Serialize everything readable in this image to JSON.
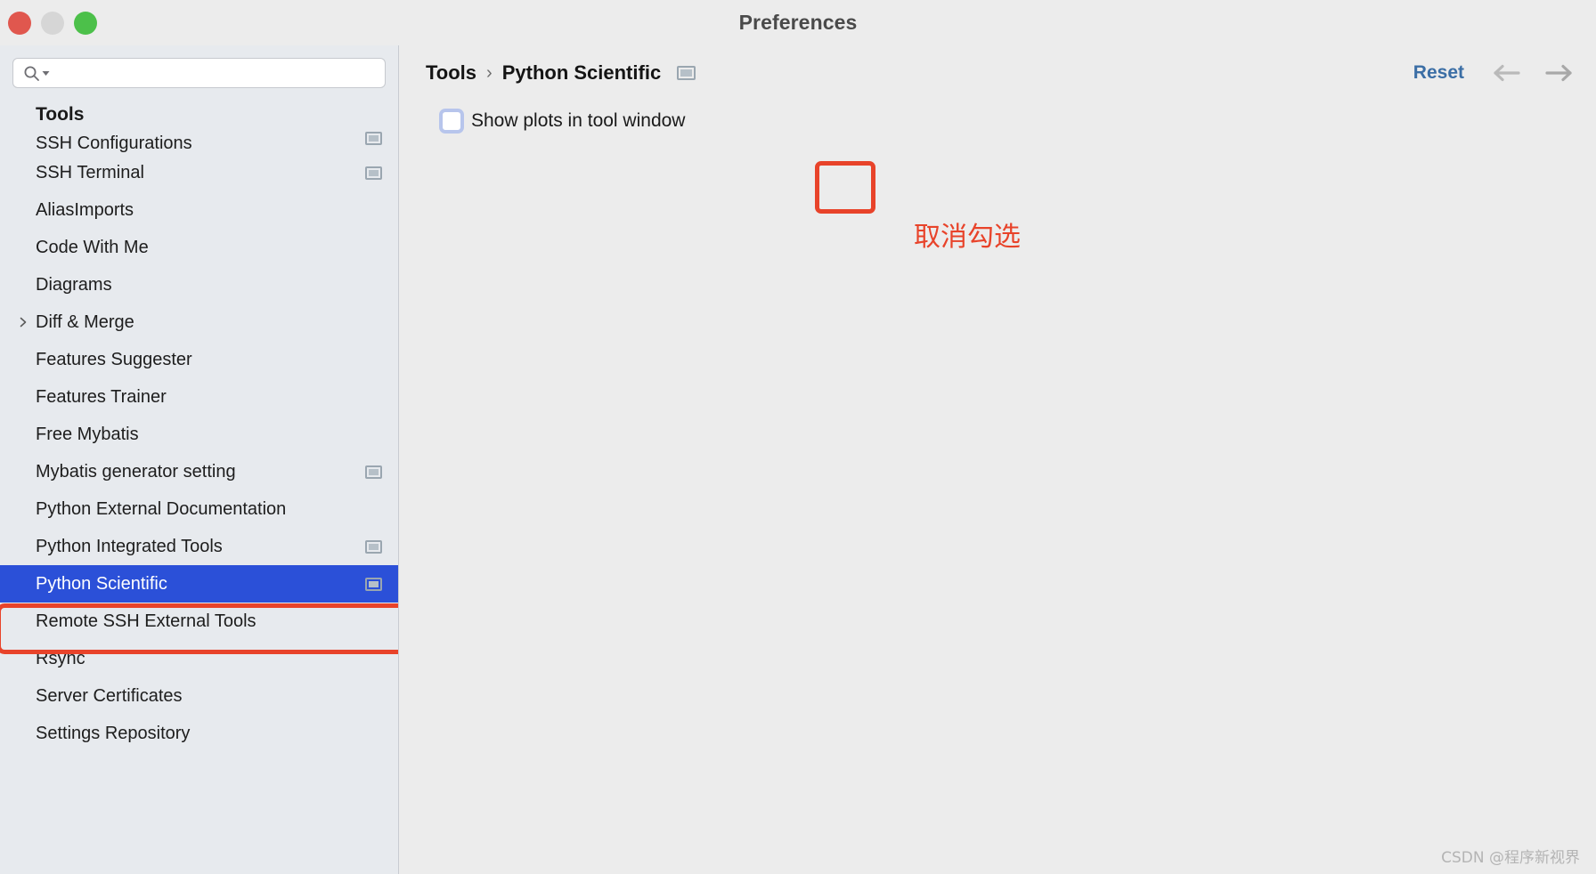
{
  "window": {
    "title": "Preferences",
    "traffic_lights": [
      "close-button",
      "minimize-button",
      "maximize-button"
    ]
  },
  "sidebar": {
    "search": {
      "value": "",
      "placeholder": "",
      "icon": "search-icon",
      "dropdown_icon": "chevron-down-icon"
    },
    "group_header": "Tools",
    "items": [
      {
        "label": "SSH Configurations",
        "panel_icon": true,
        "expandable": false,
        "selected": false,
        "clipped": true
      },
      {
        "label": "SSH Terminal",
        "panel_icon": true,
        "expandable": false,
        "selected": false
      },
      {
        "label": "AliasImports",
        "panel_icon": false,
        "expandable": false,
        "selected": false
      },
      {
        "label": "Code With Me",
        "panel_icon": false,
        "expandable": false,
        "selected": false
      },
      {
        "label": "Diagrams",
        "panel_icon": false,
        "expandable": false,
        "selected": false
      },
      {
        "label": "Diff & Merge",
        "panel_icon": false,
        "expandable": true,
        "selected": false
      },
      {
        "label": "Features Suggester",
        "panel_icon": false,
        "expandable": false,
        "selected": false
      },
      {
        "label": "Features Trainer",
        "panel_icon": false,
        "expandable": false,
        "selected": false
      },
      {
        "label": "Free Mybatis",
        "panel_icon": false,
        "expandable": false,
        "selected": false
      },
      {
        "label": "Mybatis generator setting",
        "panel_icon": true,
        "expandable": false,
        "selected": false
      },
      {
        "label": "Python External Documentation",
        "panel_icon": false,
        "expandable": false,
        "selected": false
      },
      {
        "label": "Python Integrated Tools",
        "panel_icon": true,
        "expandable": false,
        "selected": false
      },
      {
        "label": "Python Scientific",
        "panel_icon": true,
        "expandable": false,
        "selected": true
      },
      {
        "label": "Remote SSH External Tools",
        "panel_icon": false,
        "expandable": false,
        "selected": false
      },
      {
        "label": "Rsync",
        "panel_icon": false,
        "expandable": false,
        "selected": false
      },
      {
        "label": "Server Certificates",
        "panel_icon": false,
        "expandable": false,
        "selected": false
      },
      {
        "label": "Settings Repository",
        "panel_icon": false,
        "expandable": false,
        "selected": false
      }
    ]
  },
  "main": {
    "breadcrumb": {
      "root": "Tools",
      "separator": "›",
      "current": "Python Scientific",
      "panel_icon": "panel-window-icon"
    },
    "reset_label": "Reset",
    "back_icon": "arrow-left-icon",
    "forward_icon": "arrow-right-icon",
    "settings": {
      "show_plots": {
        "label": "Show plots in tool window",
        "checked": false
      }
    }
  },
  "annotations": {
    "checkbox_box": "red-highlight-rectangle",
    "sidebar_box": "red-highlight-rectangle",
    "note_text": "取消勾选",
    "note_color": "#e8432a"
  },
  "watermark": {
    "text": "CSDN @程序新视界"
  },
  "colors": {
    "selection_blue": "#2b50d8",
    "reset_blue": "#3b6ea5",
    "annotation_red": "#e8432a",
    "sidebar_bg": "#e7eaee",
    "main_bg": "#ececec"
  }
}
